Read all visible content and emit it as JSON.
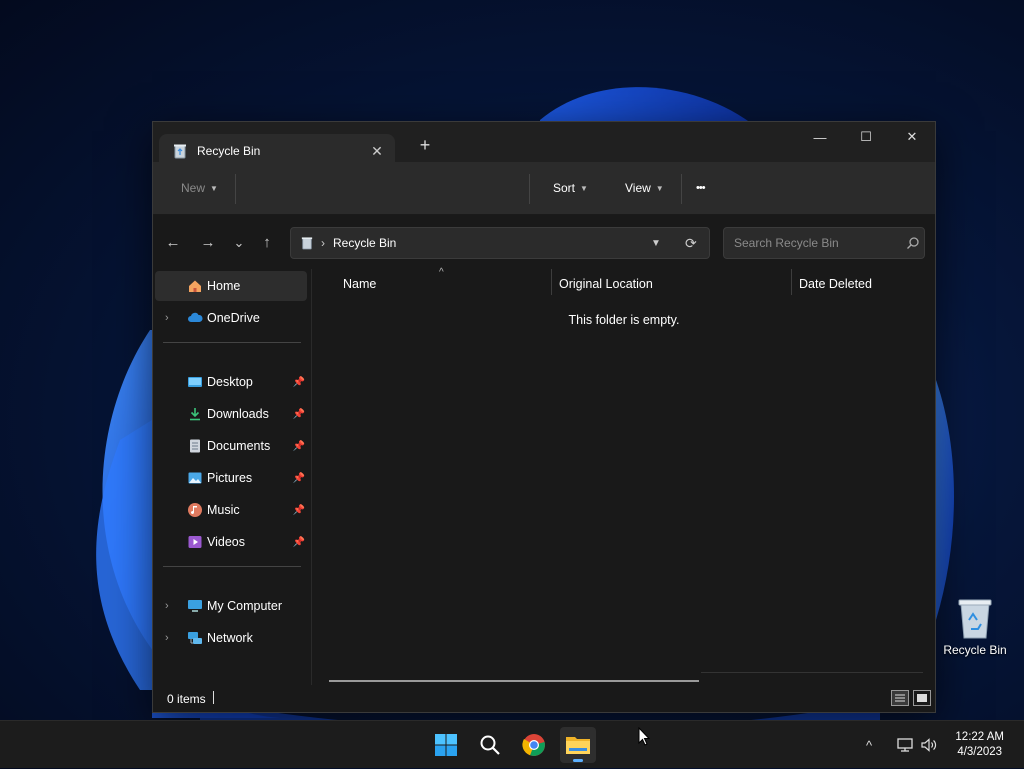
{
  "window": {
    "tab_title": "Recycle Bin",
    "tab_close": "✕",
    "new_tab": "+",
    "minimize": "—",
    "maximize": "☐",
    "close": "✕"
  },
  "toolbar": {
    "new_label": "New",
    "sort_label": "Sort",
    "view_label": "View",
    "more_label": "•••"
  },
  "navigation": {
    "back": "←",
    "forward": "→",
    "recent": "⌄",
    "up": "↑",
    "breadcrumb_separator": "›",
    "location": "Recycle Bin",
    "refresh": "⟳",
    "search_placeholder": "Search Recycle Bin"
  },
  "sidebar": {
    "items": [
      {
        "label": "Home",
        "active": true
      },
      {
        "label": "OneDrive"
      },
      {
        "label": "Desktop",
        "pinned": true
      },
      {
        "label": "Downloads",
        "pinned": true
      },
      {
        "label": "Documents",
        "pinned": true
      },
      {
        "label": "Pictures",
        "pinned": true
      },
      {
        "label": "Music",
        "pinned": true
      },
      {
        "label": "Videos",
        "pinned": true
      },
      {
        "label": "My Computer"
      },
      {
        "label": "Network"
      }
    ]
  },
  "content": {
    "columns": [
      "Name",
      "Original Location",
      "Date Deleted"
    ],
    "empty_message": "This folder is empty."
  },
  "status": {
    "item_count": "0 items"
  },
  "desktop": {
    "icons": [
      {
        "label": "Recycle Bin"
      }
    ]
  },
  "taskbar": {
    "time": "12:22 AM",
    "date": "4/3/2023",
    "tray_overflow": "^"
  },
  "colors": {
    "accent": "#5cb0ff",
    "window_bg": "#191919",
    "toolbar_bg": "#2b2b2b",
    "taskbar_bg": "#1c1c1c"
  }
}
